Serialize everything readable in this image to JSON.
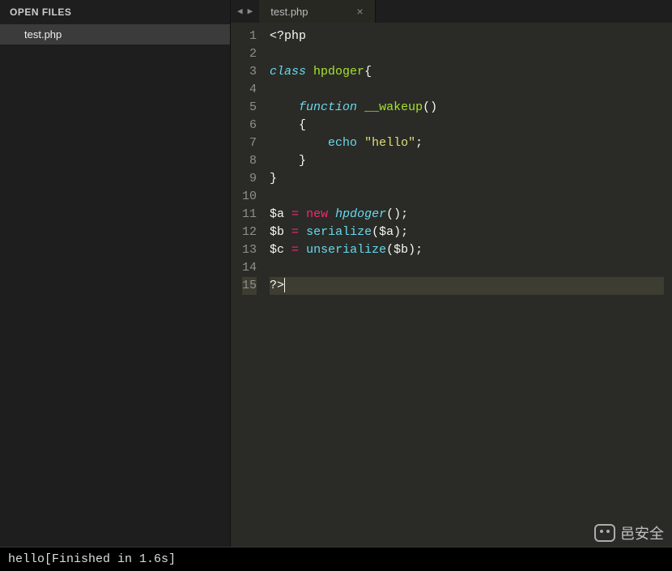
{
  "sidebar": {
    "header": "OPEN FILES",
    "items": [
      {
        "label": "test.php"
      }
    ]
  },
  "tabs": {
    "nav_prev": "◀",
    "nav_next": "▶",
    "items": [
      {
        "label": "test.php",
        "close": "×"
      }
    ]
  },
  "editor": {
    "active_line": 15,
    "lines": [
      {
        "n": 1,
        "tokens": [
          {
            "t": "<?php",
            "c": "php-tag"
          }
        ]
      },
      {
        "n": 2,
        "tokens": []
      },
      {
        "n": 3,
        "tokens": [
          {
            "t": "class",
            "c": "kw"
          },
          {
            "t": " ",
            "c": ""
          },
          {
            "t": "hpdoger",
            "c": "class-name"
          },
          {
            "t": "{",
            "c": "punct"
          }
        ]
      },
      {
        "n": 4,
        "tokens": []
      },
      {
        "n": 5,
        "tokens": [
          {
            "t": "    ",
            "c": ""
          },
          {
            "t": "function",
            "c": "fn"
          },
          {
            "t": " ",
            "c": ""
          },
          {
            "t": "__wakeup",
            "c": "class-name"
          },
          {
            "t": "()",
            "c": "punct"
          }
        ]
      },
      {
        "n": 6,
        "tokens": [
          {
            "t": "    {",
            "c": "punct"
          }
        ]
      },
      {
        "n": 7,
        "tokens": [
          {
            "t": "        ",
            "c": ""
          },
          {
            "t": "echo",
            "c": "builtin"
          },
          {
            "t": " ",
            "c": ""
          },
          {
            "t": "\"hello\"",
            "c": "str"
          },
          {
            "t": ";",
            "c": "punct"
          }
        ]
      },
      {
        "n": 8,
        "tokens": [
          {
            "t": "    }",
            "c": "punct"
          }
        ]
      },
      {
        "n": 9,
        "tokens": [
          {
            "t": "}",
            "c": "punct"
          }
        ]
      },
      {
        "n": 10,
        "tokens": []
      },
      {
        "n": 11,
        "tokens": [
          {
            "t": "$a",
            "c": "var"
          },
          {
            "t": " ",
            "c": ""
          },
          {
            "t": "=",
            "c": "op"
          },
          {
            "t": " ",
            "c": ""
          },
          {
            "t": "new",
            "c": "new"
          },
          {
            "t": " ",
            "c": ""
          },
          {
            "t": "hpdoger",
            "c": "kw"
          },
          {
            "t": "();",
            "c": "punct"
          }
        ]
      },
      {
        "n": 12,
        "tokens": [
          {
            "t": "$b",
            "c": "var"
          },
          {
            "t": " ",
            "c": ""
          },
          {
            "t": "=",
            "c": "op"
          },
          {
            "t": " ",
            "c": ""
          },
          {
            "t": "serialize",
            "c": "call"
          },
          {
            "t": "(",
            "c": "punct"
          },
          {
            "t": "$a",
            "c": "var"
          },
          {
            "t": ");",
            "c": "punct"
          }
        ]
      },
      {
        "n": 13,
        "tokens": [
          {
            "t": "$c",
            "c": "var"
          },
          {
            "t": " ",
            "c": ""
          },
          {
            "t": "=",
            "c": "op"
          },
          {
            "t": " ",
            "c": ""
          },
          {
            "t": "unserialize",
            "c": "call"
          },
          {
            "t": "(",
            "c": "punct"
          },
          {
            "t": "$b",
            "c": "var"
          },
          {
            "t": ");",
            "c": "punct"
          }
        ]
      },
      {
        "n": 14,
        "tokens": []
      },
      {
        "n": 15,
        "tokens": [
          {
            "t": "?>",
            "c": "php-tag"
          }
        ]
      }
    ]
  },
  "console": {
    "output": "hello[Finished in 1.6s]"
  },
  "watermark": {
    "text": "邑安全"
  }
}
